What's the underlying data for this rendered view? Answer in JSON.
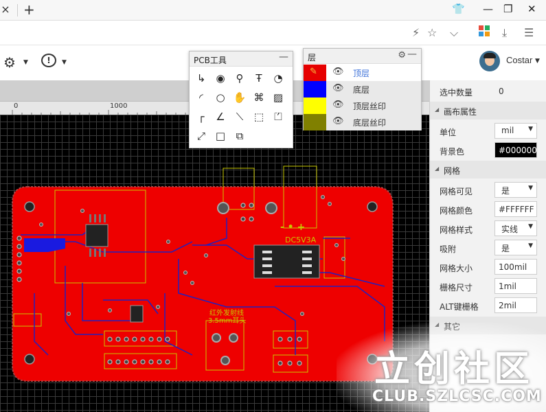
{
  "browser": {
    "close_tab": "×",
    "new_tab": "+",
    "icons": [
      "shirt-icon",
      "minimize-icon",
      "restore-icon",
      "close-icon",
      "flash-icon",
      "star-icon",
      "chevron-down-icon",
      "apps-icon",
      "download-icon",
      "menu-icon"
    ]
  },
  "toolbar": {
    "settings_icon": "gear-icon",
    "help_icon": "chat-bubble-icon",
    "user_name": "Costar"
  },
  "ruler": {
    "labels": [
      "0",
      "1000"
    ]
  },
  "pcb_tools": {
    "title": "PCB工具",
    "tools": [
      "wire",
      "pad",
      "via",
      "text",
      "arc",
      "circle-arc",
      "circle",
      "pan",
      "drill",
      "image",
      "corner",
      "angle",
      "connect",
      "rect-dashed",
      "solid-region",
      "dimension",
      "rectangle",
      "copper-area"
    ]
  },
  "layers": {
    "title": "层",
    "items": [
      {
        "name": "顶层",
        "color": "#e60000",
        "active": true
      },
      {
        "name": "底层",
        "color": "#0000ff",
        "active": false
      },
      {
        "name": "顶层丝印",
        "color": "#ffff00",
        "active": false
      },
      {
        "name": "底层丝印",
        "color": "#808000",
        "active": false
      }
    ]
  },
  "properties": {
    "selected_count_label": "选中数量",
    "selected_count_value": "0",
    "canvas_section": "画布属性",
    "unit_label": "单位",
    "unit_value": "mil",
    "bg_label": "背景色",
    "bg_value": "#000000",
    "grid_section": "网格",
    "grid_visible_label": "网格可见",
    "grid_visible_value": "是",
    "grid_color_label": "网格颜色",
    "grid_color_value": "#FFFFFF",
    "grid_style_label": "网格样式",
    "grid_style_value": "实线",
    "snap_label": "吸附",
    "snap_value": "是",
    "grid_size_label": "网格大小",
    "grid_size_value": "100mil",
    "snap_size_label": "栅格尺寸",
    "snap_size_value": "1mil",
    "alt_snap_label": "ALT键栅格",
    "alt_snap_value": "2mil",
    "other_section": "其它"
  },
  "board": {
    "silk_label_1": "DC5V3A",
    "silk_label_2": "红外发射线",
    "silk_label_3": "3.5mm耳头",
    "silk_label_4": "- • +"
  },
  "watermark": {
    "big": "立创社区",
    "small": "CLUB.SZLCSC.COM"
  }
}
